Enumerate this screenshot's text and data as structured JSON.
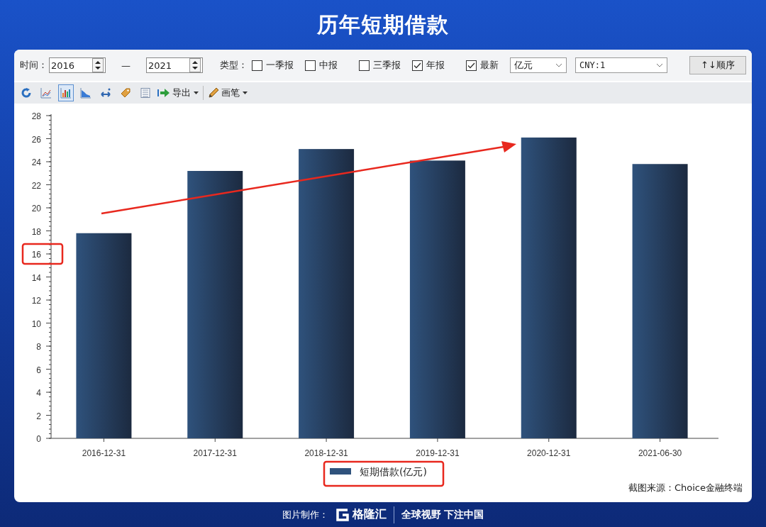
{
  "title": "历年短期借款",
  "filters": {
    "time_label": "时间：",
    "from": "2016",
    "separator": "—",
    "to": "2021",
    "type_label": "类型：",
    "types": [
      {
        "label": "一季报",
        "checked": false
      },
      {
        "label": "中报",
        "checked": false
      },
      {
        "label": "三季报",
        "checked": false
      },
      {
        "label": "年报",
        "checked": true
      },
      {
        "label": "最新",
        "checked": true
      }
    ],
    "unit": "亿元",
    "currency": "CNY:1",
    "sort_button": "↑↓顺序"
  },
  "toolbar": {
    "tools": [
      {
        "kind": "refresh",
        "selected": false
      },
      {
        "kind": "line",
        "selected": false
      },
      {
        "kind": "bar",
        "selected": true
      },
      {
        "kind": "area",
        "selected": false
      },
      {
        "kind": "swap",
        "selected": false
      },
      {
        "kind": "tag",
        "selected": false
      },
      {
        "kind": "list",
        "selected": false
      }
    ],
    "export": "导出",
    "pen": "画笔"
  },
  "chart_data": {
    "type": "bar",
    "categories": [
      "2016-12-31",
      "2017-12-31",
      "2018-12-31",
      "2019-12-31",
      "2020-12-31",
      "2021-06-30"
    ],
    "series": [
      {
        "name": "短期借款(亿元)",
        "color": "#2f527c",
        "values": [
          17.8,
          23.2,
          25.1,
          24.1,
          26.1,
          23.8
        ]
      }
    ],
    "ylim": [
      0,
      28
    ],
    "yticks": [
      0,
      2,
      4,
      6,
      8,
      10,
      12,
      14,
      16,
      18,
      20,
      22,
      24,
      26,
      28
    ]
  },
  "source": "截图来源：Choice金融终端",
  "footer": {
    "made_by": "图片制作：",
    "logo": "格隆汇",
    "slogan": "全球视野 下注中国"
  }
}
